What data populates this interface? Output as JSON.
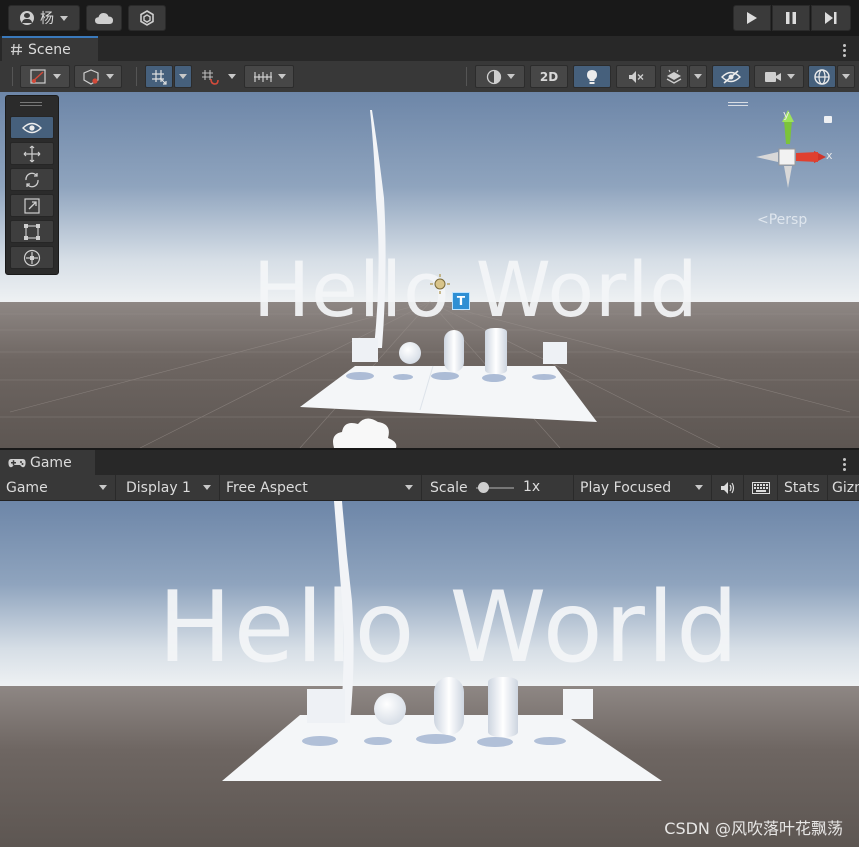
{
  "top_toolbar": {
    "account_label": "杨",
    "play_icon": "play-icon",
    "pause_icon": "pause-icon",
    "step_icon": "step-icon"
  },
  "scene_tab": {
    "label": "Scene"
  },
  "scene_toolbar": {
    "mode_2d": "2D"
  },
  "scene_view": {
    "gizmo": {
      "y_label": "y",
      "x_label": "x",
      "projection_label": "<Persp"
    },
    "text": "Hello World"
  },
  "game_tab": {
    "label": "Game"
  },
  "game_toolbar": {
    "view": "Game",
    "display": "Display 1",
    "aspect": "Free Aspect",
    "scale_label": "Scale",
    "scale_value": "1x",
    "play_mode": "Play Focused",
    "stats": "Stats",
    "gizmos": "Gizm"
  },
  "game_view": {
    "text": "Hello World"
  },
  "watermark": "CSDN @风吹落叶花飘荡",
  "colors": {
    "accent": "#46607c",
    "panel": "#383838",
    "background": "#191919"
  }
}
